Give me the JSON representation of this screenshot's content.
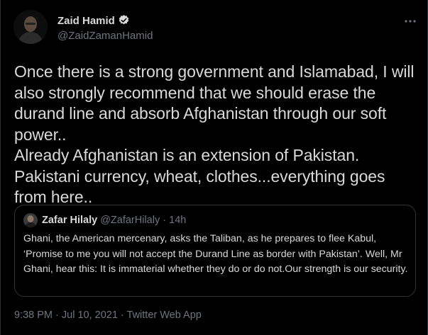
{
  "author": {
    "name": "Zaid Hamid",
    "handle": "@ZaidZamanHamid",
    "verified": true
  },
  "tweet": {
    "text": "Once there is a strong government and Islamabad, I will\nalso strongly recommend that we should erase the\ndurand line and absorb Afghanistan through our soft\npower..\nAlready Afghanistan is an extension of Pakistan.\nPakistani currency, wheat, clothes...everything goes\nfrom here.."
  },
  "quoted": {
    "name": "Zafar Hilaly",
    "handle": "@ZafarHilaly",
    "separator": "·",
    "time": "14h",
    "text": "Ghani, the American mercenary, asks the Taliban, as he prepares to flee Kabul, ‘Promise to me you will not accept the Durand Line as border with Pakistan’. Well, Mr Ghani, hear this: It is immaterial whether they do or do not.Our strength is our security."
  },
  "meta": {
    "time": "9:38 PM",
    "date": "Jul 10, 2021",
    "source": "Twitter Web App",
    "separator": " · "
  },
  "icons": {
    "more": "more-horizontal-icon",
    "verified": "verified-badge-icon"
  },
  "colors": {
    "background": "#000000",
    "text": "#d9d9d9",
    "muted": "#6e767d",
    "border": "#2f3336"
  }
}
